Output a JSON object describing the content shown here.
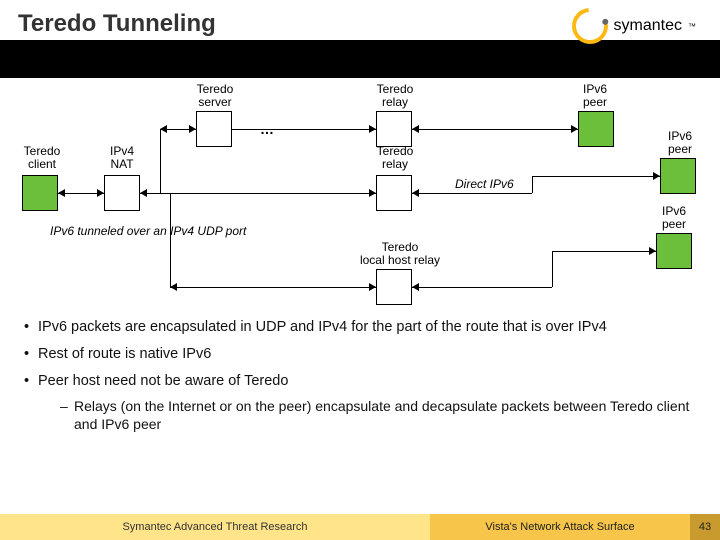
{
  "header": {
    "title": "Teredo Tunneling",
    "brand": "symantec",
    "tm": "™"
  },
  "diagram": {
    "labels": {
      "teredo_client": "Teredo\nclient",
      "ipv4_nat": "IPv4\nNAT",
      "teredo_server": "Teredo\nserver",
      "teredo_relay": "Teredo\nrelay",
      "teredo_relay2": "Teredo\nrelay",
      "teredo_local_relay": "Teredo\nlocal host relay",
      "ipv6_peer1": "IPv6\npeer",
      "ipv6_peer2": "IPv6\npeer",
      "ipv6_peer3": "IPv6\npeer",
      "direct_ipv6": "Direct IPv6",
      "tunneled": "IPv6 tunneled over an IPv4 UDP port",
      "ellipsis": "…"
    }
  },
  "bullets": {
    "b1": "IPv6 packets are encapsulated in UDP and IPv4 for the part of the route that is over IPv4",
    "b2": "Rest of route is native IPv6",
    "b3": "Peer host need not be aware of Teredo",
    "s1": "Relays (on the Internet or on the peer) encapsulate and decapsulate packets between Teredo client and IPv6 peer"
  },
  "footer": {
    "left": "Symantec Advanced Threat Research",
    "center": "Vista's Network Attack Surface",
    "page": "43"
  }
}
